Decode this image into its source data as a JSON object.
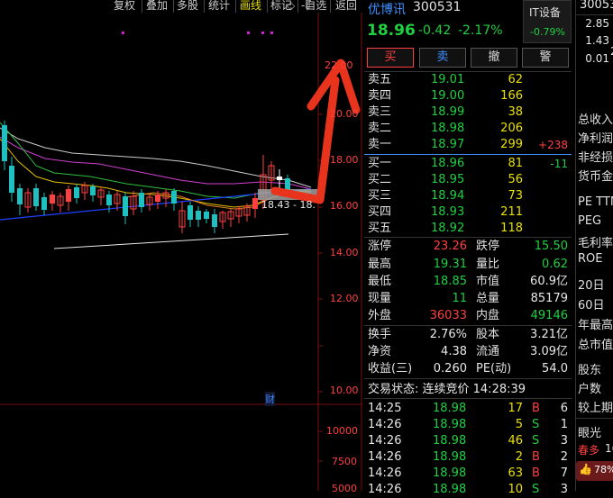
{
  "toolbar": {
    "items": [
      "复权",
      "叠加",
      "多股",
      "统计",
      "画线",
      "标记",
      "-自选",
      "返回"
    ],
    "diamond": "◇",
    "page_icon": "▯"
  },
  "chart": {
    "y_labels": [
      "20.00",
      "18.00",
      "16.00",
      "14.00",
      "12.00",
      "10.00"
    ],
    "vol_labels": [
      "10000",
      "7500",
      "5000"
    ],
    "price_tag": "18.43 - 18.",
    "cai_marker": "财"
  },
  "quote": {
    "name": "优博讯",
    "code": "300531",
    "sector_label": "IT设备",
    "sector_change": "-0.79%",
    "price": "18.96",
    "change": "-0.42",
    "change_pct": "-2.17%",
    "buttons": {
      "buy": "买",
      "sell": "卖",
      "cancel": "撤",
      "alert": "警"
    },
    "asks": [
      {
        "label": "卖五",
        "price": "19.01",
        "vol": "62",
        "delta": ""
      },
      {
        "label": "卖四",
        "price": "19.00",
        "vol": "166",
        "delta": ""
      },
      {
        "label": "卖三",
        "price": "18.99",
        "vol": "38",
        "delta": ""
      },
      {
        "label": "卖二",
        "price": "18.98",
        "vol": "206",
        "delta": ""
      },
      {
        "label": "卖一",
        "price": "18.97",
        "vol": "299",
        "delta": "+238"
      }
    ],
    "bids": [
      {
        "label": "买一",
        "price": "18.96",
        "vol": "81",
        "delta": "-11"
      },
      {
        "label": "买二",
        "price": "18.95",
        "vol": "56",
        "delta": ""
      },
      {
        "label": "买三",
        "price": "18.94",
        "vol": "73",
        "delta": ""
      },
      {
        "label": "买四",
        "price": "18.93",
        "vol": "211",
        "delta": ""
      },
      {
        "label": "买五",
        "price": "18.92",
        "vol": "118",
        "delta": ""
      }
    ],
    "stats1": [
      {
        "l1": "涨停",
        "v1": "23.26",
        "l2": "跌停",
        "v2": "15.50"
      },
      {
        "l1": "最高",
        "v1": "19.31",
        "l2": "量比",
        "v2": "0.62"
      },
      {
        "l1": "最低",
        "v1": "18.85",
        "l2": "市值",
        "v2": "60.9亿"
      },
      {
        "l1": "现量",
        "v1": "11",
        "l2": "总量",
        "v2": "85179"
      },
      {
        "l1": "外盘",
        "v1": "36033",
        "l2": "内盘",
        "v2": "49146"
      }
    ],
    "stats2": [
      {
        "l1": "换手",
        "v1": "2.76%",
        "l2": "股本",
        "v2": "3.21亿"
      },
      {
        "l1": "净资",
        "v1": "4.38",
        "l2": "流通",
        "v2": "3.09亿"
      },
      {
        "l1": "收益(三)",
        "v1": "0.260",
        "l2": "PE(动)",
        "v2": "54.0"
      }
    ],
    "trade_status": "交易状态: 连续竞价 14:28:39",
    "ticks": [
      {
        "time": "14:25",
        "price": "18.98",
        "vol": "17",
        "bs": "B",
        "n": "6"
      },
      {
        "time": "14:26",
        "price": "18.98",
        "vol": "5",
        "bs": "S",
        "n": "1"
      },
      {
        "time": "14:26",
        "price": "18.98",
        "vol": "46",
        "bs": "S",
        "n": "3"
      },
      {
        "time": "14:26",
        "price": "18.98",
        "vol": "2",
        "bs": "B",
        "n": "2"
      },
      {
        "time": "14:26",
        "price": "18.98",
        "vol": "63",
        "bs": "B",
        "n": "7"
      },
      {
        "time": "14:26",
        "price": "18.98",
        "vol": "10",
        "bs": "S",
        "n": "3"
      }
    ]
  },
  "far_panel": {
    "code": "30053",
    "small_vals": [
      "2.85",
      "1.43",
      "0.01"
    ],
    "bigcol_val": "2",
    "labels": [
      "总收入",
      "净利润",
      "非经损",
      "货币金",
      "PE TTM",
      "PEG",
      "毛利率",
      "ROE",
      "20日",
      "60日",
      "年最高",
      "总市值",
      "股东",
      "户数",
      "较上期"
    ],
    "eye": "眼光",
    "spring": "春多",
    "spring_val": "16",
    "thumb_val": "78%"
  },
  "colors": {
    "up": "#ff4040",
    "down": "#20d040",
    "accent_red": "#e8341c",
    "grid_red": "#7a1010"
  }
}
